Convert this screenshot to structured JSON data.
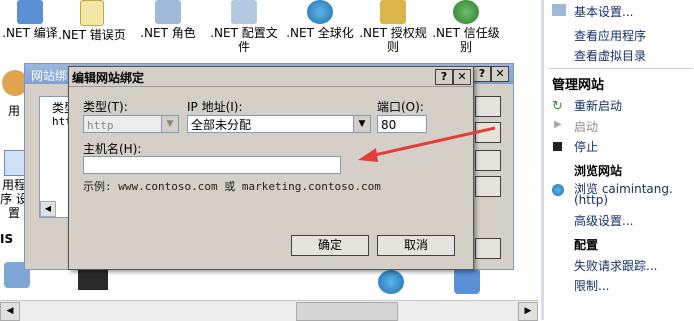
{
  "features": {
    "row1": [
      {
        "label": ".NET 编译",
        "icon": "net-compile-icon"
      },
      {
        "label": ".NET 错误页",
        "icon": "net-error-page-icon"
      },
      {
        "label": ".NET 角色",
        "icon": "net-roles-icon"
      },
      {
        "label": ".NET 配置文件",
        "icon": "net-profile-icon"
      },
      {
        "label": ".NET 全球化",
        "icon": "net-globalization-icon"
      },
      {
        "label": ".NET 授权规则",
        "icon": "net-authorization-icon"
      },
      {
        "label": ".NET 信任级别",
        "icon": "net-trust-icon"
      }
    ],
    "left_partial": [
      {
        "label": "用",
        "icon": "users-icon"
      },
      {
        "label": "用程序 设置",
        "icon": "app-settings-icon"
      },
      {
        "label": "IS",
        "icon": ""
      }
    ]
  },
  "bg_dialog": {
    "title": "网站绑定",
    "col_type_partial": "类型",
    "row_partial": "http",
    "close": "✕"
  },
  "dialog": {
    "title": "编辑网站绑定",
    "help_btn": "?",
    "close_btn": "✕",
    "type_label": "类型(T):",
    "type_value": "http",
    "ip_label": "IP 地址(I):",
    "ip_value": "全部未分配",
    "port_label": "端口(O):",
    "port_value": "80",
    "host_label": "主机名(H):",
    "host_value": "",
    "example": "示例: www.contoso.com 或 marketing.contoso.com",
    "ok": "确定",
    "cancel": "取消"
  },
  "actions": {
    "basic_settings": "基本设置...",
    "view_apps": "查看应用程序",
    "view_vdirs": "查看虚拟目录",
    "manage_site": "管理网站",
    "restart": "重新启动",
    "start": "启动",
    "stop": "停止",
    "browse_site": "浏览网站",
    "browse_link": "浏览 caimintang.",
    "browse_link2": "(http)",
    "advanced": "高级设置...",
    "configure": "配置",
    "failed_requests": "失败请求跟踪...",
    "limits": "限制..."
  },
  "colors": {
    "arrow": "#e63c3c",
    "accent": "#15306b"
  }
}
